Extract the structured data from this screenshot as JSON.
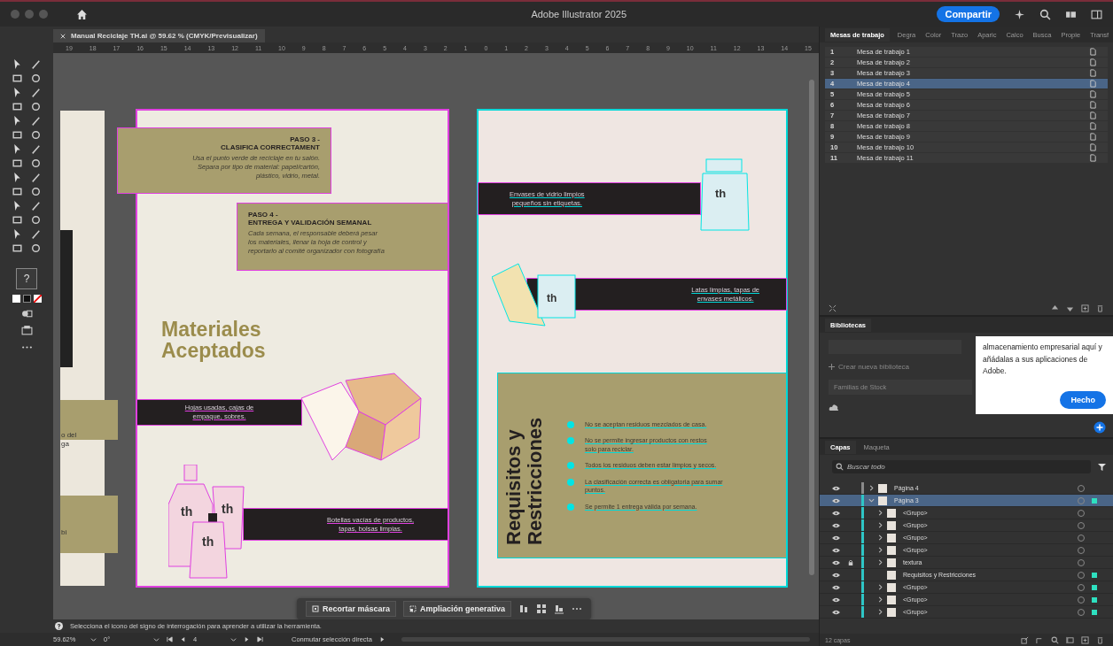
{
  "window": {
    "title": "Adobe Illustrator 2025",
    "share_button": "Compartir"
  },
  "document_tab": {
    "title": "Manual Reciclaje TH.ai @ 59.62 % (CMYK/Previsualizar)"
  },
  "ruler": {
    "marks": [
      "19",
      "18",
      "17",
      "16",
      "15",
      "14",
      "13",
      "12",
      "11",
      "10",
      "9",
      "8",
      "7",
      "6",
      "5",
      "4",
      "3",
      "2",
      "1",
      "0",
      "1",
      "2",
      "3",
      "4",
      "5",
      "6",
      "7",
      "8",
      "9",
      "10",
      "11",
      "12",
      "13",
      "14",
      "15"
    ]
  },
  "toolbar": {
    "help_label": "?"
  },
  "canvas": {
    "edge_page": {
      "texts": [
        "o del",
        "ga",
        "bi"
      ]
    },
    "left_page": {
      "step3": {
        "title": "PASO 3 -",
        "subtitle": "CLASIFICA CORRECTAMENT",
        "body": [
          "Usa el punto verde de reciclaje en tu salón.",
          "Separa por tipo de material: papel/cartón,",
          "plástico, vidrio, metal."
        ]
      },
      "step4": {
        "title": "PASO 4 -",
        "subtitle": "ENTREGA Y VALIDACIÓN SEMANAL",
        "body": [
          "Cada semana, el responsable deberá pesar",
          "los materiales, llenar la hoja de control y",
          "reportarlo al comité organizador con fotografía"
        ]
      },
      "heading": [
        "Materiales",
        "Aceptados"
      ],
      "band_top": [
        "Hojas usadas, cajas de",
        "empaque, sobres."
      ],
      "band_bottom": [
        "Botellas vacías de productos,",
        "tapas, bolsas limpias."
      ],
      "bottle_labels": [
        "th",
        "th",
        "th"
      ]
    },
    "right_page": {
      "band_top": [
        "Envases de vidrio limpios",
        "pequeños sin etiquetas."
      ],
      "band_middle": [
        "Latas limpias, tapas de",
        "envases metálicos."
      ],
      "jar_labels": [
        "th",
        "th"
      ],
      "panel_title": [
        "Requisitos y",
        "Restricciones"
      ],
      "rules": [
        [
          "No se aceptan residuos mezclados de casa."
        ],
        [
          "No se permite ingresar productos con restos",
          "solo para reciclar."
        ],
        [
          "Todos los residuos deben estar limpios y secos."
        ],
        [
          "La clasificación correcta es obligatoria para sumar",
          "puntos."
        ],
        [
          "Se permite 1 entrega válida por semana."
        ]
      ]
    }
  },
  "context_bar": {
    "buttons": [
      "Recortar máscara",
      "Ampliación generativa"
    ]
  },
  "status_hint": "Selecciona el icono del signo de interrogación para aprender a utilizar la herramienta.",
  "bottom_bar": {
    "zoom": "59.62%",
    "rotation": "0°",
    "artboard": "4",
    "mode": "Conmutar selección directa"
  },
  "artboards_panel": {
    "tabs": [
      {
        "label": "Mesas de trabajo",
        "selected": true
      },
      {
        "label": "Degra",
        "selected": false
      },
      {
        "label": "Color",
        "selected": false
      },
      {
        "label": "Trazo",
        "selected": false
      },
      {
        "label": "Aparic",
        "selected": false
      },
      {
        "label": "Calco",
        "selected": false
      },
      {
        "label": "Busca",
        "selected": false
      },
      {
        "label": "Propie",
        "selected": false
      },
      {
        "label": "Transf",
        "selected": false
      }
    ],
    "rows": [
      {
        "number": "1",
        "name": "Mesa de trabajo 1",
        "selected": false
      },
      {
        "number": "2",
        "name": "Mesa de trabajo 2",
        "selected": false
      },
      {
        "number": "3",
        "name": "Mesa de trabajo 3",
        "selected": false
      },
      {
        "number": "4",
        "name": "Mesa de trabajo 4",
        "selected": true
      },
      {
        "number": "5",
        "name": "Mesa de trabajo 5",
        "selected": false
      },
      {
        "number": "6",
        "name": "Mesa de trabajo 6",
        "selected": false
      },
      {
        "number": "7",
        "name": "Mesa de trabajo 7",
        "selected": false
      },
      {
        "number": "8",
        "name": "Mesa de trabajo 8",
        "selected": false
      },
      {
        "number": "9",
        "name": "Mesa de trabajo 9",
        "selected": false
      },
      {
        "number": "10",
        "name": "Mesa de trabajo 10",
        "selected": false
      },
      {
        "number": "11",
        "name": "Mesa de trabajo 11",
        "selected": false
      }
    ]
  },
  "libraries_panel": {
    "title": "Bibliotecas",
    "create_label": "Crear nueva biblioteca",
    "item": "Familias de Stock"
  },
  "popover": {
    "text": "almacenamiento empresarial aquí y añádalas a sus aplicaciones de Adobe.",
    "button": "Hecho"
  },
  "layers_panel": {
    "tabs": [
      {
        "label": "Capas",
        "selected": true
      },
      {
        "label": "Maqueta",
        "selected": false
      }
    ],
    "search_placeholder": "Buscar todo",
    "count": "12 capas",
    "layers": [
      {
        "name": "Página 4",
        "color": "#8a8a8a",
        "expanded": false,
        "selected": false,
        "locked": false,
        "targeted": false
      },
      {
        "name": "Página 3",
        "color": "#2ec6c6",
        "expanded": true,
        "selected": true,
        "locked": false,
        "targeted": true,
        "children": [
          {
            "name": "<Grupo>",
            "expanded": false,
            "locked": false,
            "targeted": false
          },
          {
            "name": "<Grupo>",
            "expanded": false,
            "locked": false,
            "targeted": false
          },
          {
            "name": "<Grupo>",
            "expanded": false,
            "locked": false,
            "targeted": false
          },
          {
            "name": "<Grupo>",
            "expanded": false,
            "locked": false,
            "targeted": false
          },
          {
            "name": "textura",
            "expanded": false,
            "locked": true,
            "targeted": false
          },
          {
            "name": "Requisitos y  Restricciones",
            "locked": false,
            "targeted": true
          },
          {
            "name": "<Grupo>",
            "expanded": false,
            "locked": false,
            "targeted": true
          },
          {
            "name": "<Grupo>",
            "expanded": false,
            "locked": false,
            "targeted": true
          },
          {
            "name": "<Grupo>",
            "expanded": false,
            "locked": false,
            "targeted": true
          }
        ]
      }
    ]
  }
}
